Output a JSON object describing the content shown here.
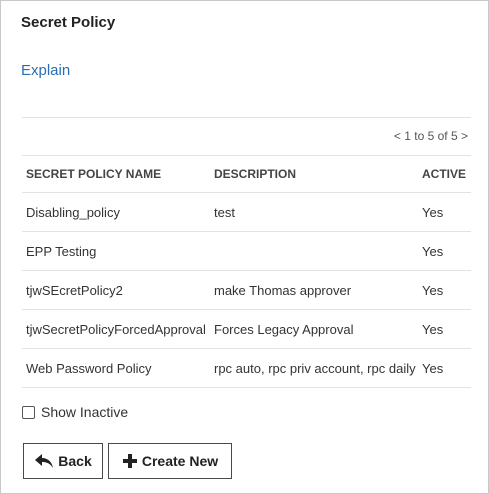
{
  "header": {
    "title": "Secret Policy",
    "explain_link": "Explain"
  },
  "pager": {
    "prev_arrow": "<",
    "range_text": "1 to 5 of 5",
    "next_arrow": ">"
  },
  "table": {
    "columns": [
      "SECRET POLICY NAME",
      "DESCRIPTION",
      "ACTIVE"
    ],
    "rows": [
      {
        "name": "Disabling_policy",
        "description": "test",
        "active": "Yes"
      },
      {
        "name": "EPP Testing",
        "description": "",
        "active": "Yes"
      },
      {
        "name": "tjwSEcretPolicy2",
        "description": "make Thomas approver",
        "active": "Yes"
      },
      {
        "name": "tjwSecretPolicyForcedApproval",
        "description": "Forces Legacy Approval",
        "active": "Yes"
      },
      {
        "name": "Web Password Policy",
        "description": "rpc auto, rpc priv account, rpc daily",
        "active": "Yes"
      }
    ]
  },
  "filters": {
    "show_inactive_label": "Show Inactive",
    "show_inactive_checked": false
  },
  "actions": {
    "back_label": "Back",
    "back_icon": "reply-arrow-icon",
    "create_label": "Create New",
    "create_icon": "plus-icon"
  },
  "colors": {
    "link": "#2a6db5",
    "border": "#c8c8c8",
    "rule": "#e2e2e2"
  }
}
